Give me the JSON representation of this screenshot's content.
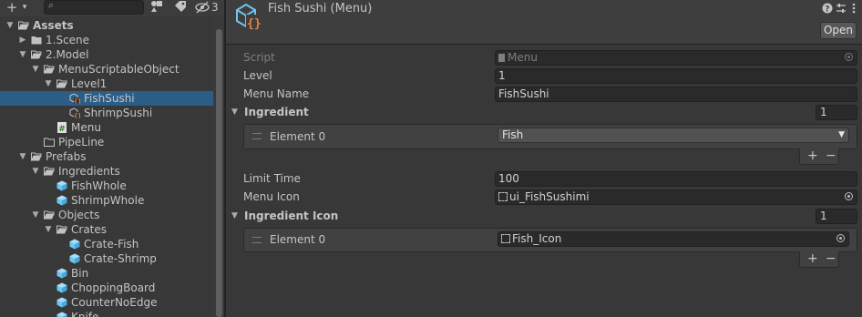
{
  "toolbar": {
    "add_label": "+",
    "add_arrow": "▾",
    "search_icon": "⌕",
    "hidden_count": "3"
  },
  "tree": [
    {
      "label": "Assets",
      "depth": 0,
      "type": "folder",
      "expanded": true,
      "bold": true
    },
    {
      "label": "1.Scene",
      "depth": 1,
      "type": "folder",
      "expanded": false
    },
    {
      "label": "2.Model",
      "depth": 1,
      "type": "folder",
      "expanded": true
    },
    {
      "label": "MenuScriptableObject",
      "depth": 2,
      "type": "folder",
      "expanded": true
    },
    {
      "label": "Level1",
      "depth": 3,
      "type": "folder",
      "expanded": true
    },
    {
      "label": "FishSushi",
      "depth": 4,
      "type": "so",
      "selected": true
    },
    {
      "label": "ShrimpSushi",
      "depth": 4,
      "type": "so"
    },
    {
      "label": "Menu",
      "depth": 3,
      "type": "script"
    },
    {
      "label": "PipeLine",
      "depth": 2,
      "type": "folder-empty"
    },
    {
      "label": "Prefabs",
      "depth": 1,
      "type": "folder",
      "expanded": true
    },
    {
      "label": "Ingredients",
      "depth": 2,
      "type": "folder",
      "expanded": true
    },
    {
      "label": "FishWhole",
      "depth": 3,
      "type": "prefab"
    },
    {
      "label": "ShrimpWhole",
      "depth": 3,
      "type": "prefab"
    },
    {
      "label": "Objects",
      "depth": 2,
      "type": "folder",
      "expanded": true
    },
    {
      "label": "Crates",
      "depth": 3,
      "type": "folder",
      "expanded": true
    },
    {
      "label": "Crate-Fish",
      "depth": 4,
      "type": "prefab"
    },
    {
      "label": "Crate-Shrimp",
      "depth": 4,
      "type": "prefab"
    },
    {
      "label": "Bin",
      "depth": 3,
      "type": "prefab"
    },
    {
      "label": "ChoppingBoard",
      "depth": 3,
      "type": "prefab"
    },
    {
      "label": "CounterNoEdge",
      "depth": 3,
      "type": "prefab"
    },
    {
      "label": "Knife",
      "depth": 3,
      "type": "prefab"
    }
  ],
  "inspector": {
    "title": "Fish Sushi (Menu)",
    "open_label": "Open",
    "script_label": "Script",
    "script_value": "Menu",
    "level_label": "Level",
    "level_value": "1",
    "menu_name_label": "Menu Name",
    "menu_name_value": "FishSushi",
    "ingredient_label": "Ingredient",
    "ingredient_size": "1",
    "ingredient_element_label": "Element 0",
    "ingredient_element_value": "Fish",
    "limit_time_label": "Limit Time",
    "limit_time_value": "100",
    "menu_icon_label": "Menu Icon",
    "menu_icon_value": "ui_FishSushimi",
    "ingredient_icon_label": "Ingredient Icon",
    "ingredient_icon_size": "1",
    "ingredient_icon_element_label": "Element 0",
    "ingredient_icon_element_value": "Fish_Icon",
    "plus": "+",
    "minus": "−"
  },
  "colors": {
    "selection": "#2c5d87",
    "prefab_blue": "#6ec6f0",
    "so_orange": "#e8833a"
  }
}
